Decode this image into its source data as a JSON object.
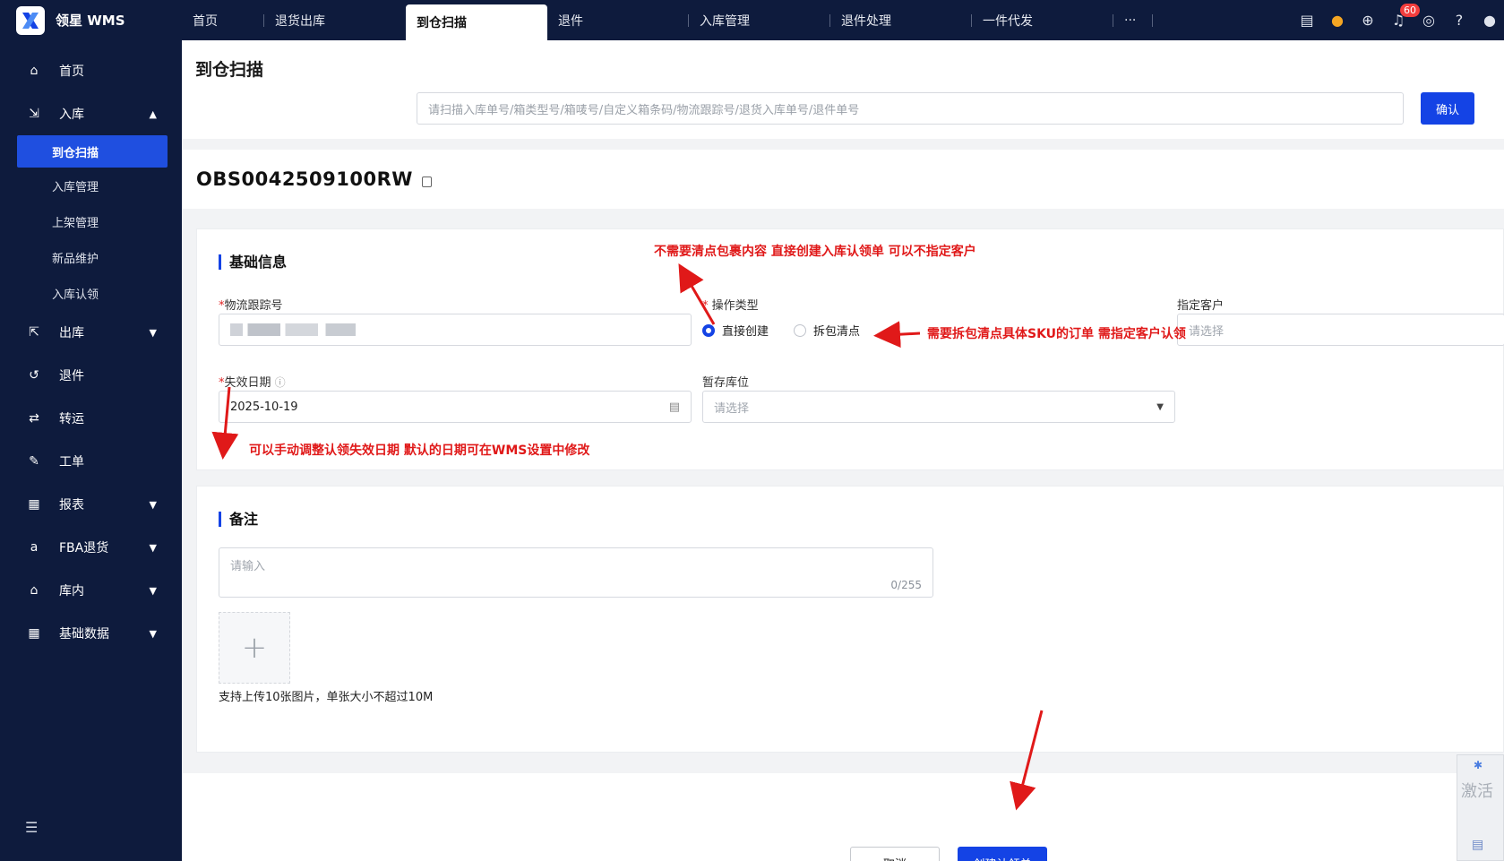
{
  "app": {
    "brand": "领星 WMS"
  },
  "tabs": [
    {
      "label": "首页"
    },
    {
      "label": "退货出库"
    },
    {
      "label": "到仓扫描"
    },
    {
      "label": "退件"
    },
    {
      "label": "入库管理"
    },
    {
      "label": "退件处理"
    },
    {
      "label": "一件代发"
    },
    {
      "label": "···"
    }
  ],
  "top_icons": {
    "notification_count": "60"
  },
  "sidebar": {
    "items": [
      {
        "label": "首页"
      },
      {
        "label": "入库"
      },
      {
        "label": "出库"
      },
      {
        "label": "退件"
      },
      {
        "label": "转运"
      },
      {
        "label": "工单"
      },
      {
        "label": "报表"
      },
      {
        "label": "FBA退货"
      },
      {
        "label": "库内"
      },
      {
        "label": "基础数据"
      }
    ],
    "sub_items": [
      {
        "label": "到仓扫描"
      },
      {
        "label": "入库管理"
      },
      {
        "label": "上架管理"
      },
      {
        "label": "新品维护"
      },
      {
        "label": "入库认领"
      }
    ]
  },
  "page": {
    "title": "到仓扫描",
    "scan_placeholder": "请扫描入库单号/箱类型号/箱唛号/自定义箱条码/物流跟踪号/退货入库单号/退件单号",
    "confirm_label": "确认",
    "order_no": "OBS0042509100RW"
  },
  "basic": {
    "title": "基础信息",
    "tracking_label": "物流跟踪号",
    "operation_label": "操作类型",
    "radio_direct": "直接创建",
    "radio_unpack": "拆包清点",
    "customer_label": "指定客户",
    "customer_placeholder": "请选择",
    "expire_label": "失效日期",
    "expire_value": "2025-10-19",
    "location_label": "暂存库位",
    "location_placeholder": "请选择"
  },
  "remark": {
    "title": "备注",
    "placeholder": "请输入",
    "counter": "0/255",
    "upload_tip": "支持上传10张图片，单张大小不超过10M"
  },
  "footer": {
    "cancel_label": "取消",
    "create_label": "创建认领单"
  },
  "annotations": {
    "a1": "不需要清点包裹内容 直接创建入库认领单 可以不指定客户",
    "a2": "需要拆包清点具体SKU的订单 需指定客户认领",
    "a3": "可以手动调整认领失效日期 默认的日期可在WMS设置中修改"
  },
  "side_widget": {
    "text": "激活"
  },
  "colors": {
    "nav_bg": "#0e1b3d",
    "primary": "#1443e5",
    "annotation": "#e01919"
  }
}
